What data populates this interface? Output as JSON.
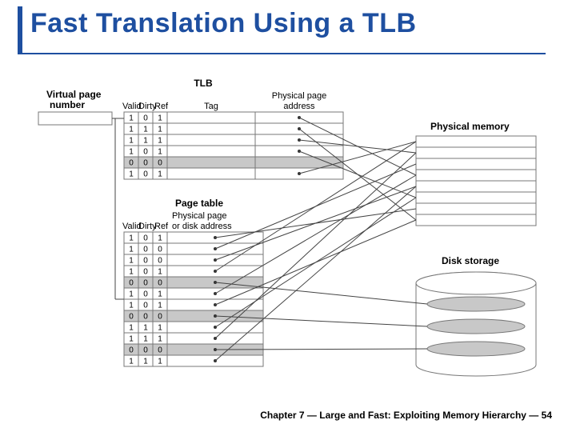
{
  "title": "Fast Translation Using a TLB",
  "footer": "Chapter 7 — Large and Fast: Exploiting Memory Hierarchy — 54",
  "labels": {
    "vpn_top": "Virtual page",
    "vpn_bot": "number",
    "tlb": "TLB",
    "tag": "Tag",
    "ppa_top": "Physical page",
    "ppa_bot": "address",
    "valid": "Valid",
    "dirty": "Dirty",
    "ref": "Ref",
    "page_table": "Page table",
    "pt_addr_top": "Physical page",
    "pt_addr_bot": "or disk address",
    "phys_mem": "Physical memory",
    "disk": "Disk storage"
  },
  "tlb": {
    "cols": [
      "Valid",
      "Dirty",
      "Ref"
    ],
    "rows": [
      {
        "v": "1",
        "d": "0",
        "r": "1",
        "shaded": false
      },
      {
        "v": "1",
        "d": "1",
        "r": "1",
        "shaded": false
      },
      {
        "v": "1",
        "d": "1",
        "r": "1",
        "shaded": false
      },
      {
        "v": "1",
        "d": "0",
        "r": "1",
        "shaded": false
      },
      {
        "v": "0",
        "d": "0",
        "r": "0",
        "shaded": true
      },
      {
        "v": "1",
        "d": "0",
        "r": "1",
        "shaded": false
      }
    ]
  },
  "page_table": {
    "cols": [
      "Valid",
      "Dirty",
      "Ref"
    ],
    "rows": [
      {
        "v": "1",
        "d": "0",
        "r": "1",
        "shaded": false
      },
      {
        "v": "1",
        "d": "0",
        "r": "0",
        "shaded": false
      },
      {
        "v": "1",
        "d": "0",
        "r": "0",
        "shaded": false
      },
      {
        "v": "1",
        "d": "0",
        "r": "1",
        "shaded": false
      },
      {
        "v": "0",
        "d": "0",
        "r": "0",
        "shaded": true
      },
      {
        "v": "1",
        "d": "0",
        "r": "1",
        "shaded": false
      },
      {
        "v": "1",
        "d": "0",
        "r": "1",
        "shaded": false
      },
      {
        "v": "0",
        "d": "0",
        "r": "0",
        "shaded": true
      },
      {
        "v": "1",
        "d": "1",
        "r": "1",
        "shaded": false
      },
      {
        "v": "1",
        "d": "1",
        "r": "1",
        "shaded": false
      },
      {
        "v": "0",
        "d": "0",
        "r": "0",
        "shaded": true
      },
      {
        "v": "1",
        "d": "1",
        "r": "1",
        "shaded": false
      }
    ]
  },
  "phys_mem_rows": 8,
  "disk_platters": 3,
  "tlb_links": [
    {
      "row": 0,
      "mem": 3
    },
    {
      "row": 1,
      "mem": 7
    },
    {
      "row": 2,
      "mem": 1
    },
    {
      "row": 3,
      "mem": 5
    },
    {
      "row": 5,
      "mem": 0
    }
  ],
  "pt_links_mem": [
    {
      "row": 0,
      "mem": 6
    },
    {
      "row": 1,
      "mem": 2
    },
    {
      "row": 2,
      "mem": 4
    },
    {
      "row": 3,
      "mem": 0
    },
    {
      "row": 5,
      "mem": 3
    },
    {
      "row": 6,
      "mem": 7
    },
    {
      "row": 8,
      "mem": 5
    },
    {
      "row": 9,
      "mem": 1
    },
    {
      "row": 11,
      "mem": 4
    }
  ],
  "pt_links_disk": [
    {
      "row": 4,
      "platter": 0
    },
    {
      "row": 7,
      "platter": 1
    },
    {
      "row": 10,
      "platter": 2
    }
  ]
}
